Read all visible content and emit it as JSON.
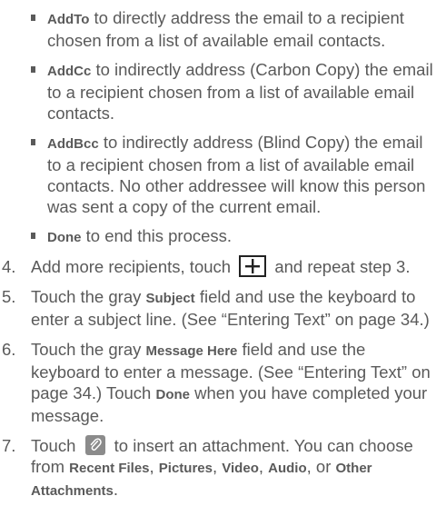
{
  "bullets": [
    {
      "term": "AddTo",
      "text": " to directly address the email to a recipient chosen from a list of available email contacts."
    },
    {
      "term": "AddCc",
      "text": " to indirectly address (Carbon Copy) the email to a recipient chosen from a list of available email contacts."
    },
    {
      "term": "AddBcc",
      "text": " to indirectly address (Blind Copy) the email to a recipient chosen from a list of available email contacts. No other addressee will know this person was sent a copy of the current email."
    },
    {
      "term": "Done",
      "text": " to end this process."
    }
  ],
  "steps": {
    "s4": {
      "num": "4.",
      "before": "Add more recipients, touch",
      "after": "and repeat step 3."
    },
    "s5": {
      "num": "5.",
      "a": "Touch the gray ",
      "term": "Subject",
      "b": " field and use the keyboard to enter a subject line. (See “Entering Text” on page 34.)"
    },
    "s6": {
      "num": "6.",
      "a": "Touch the gray ",
      "term1": "Message Here",
      "b": " field and use the keyboard to enter a message. (See “Entering Text” on page 34.) Touch ",
      "term2": "Done",
      "c": " when you have completed your message."
    },
    "s7": {
      "num": "7.",
      "a": "Touch",
      "b": "to insert an attachment. You can choose from ",
      "t1": "Recent Files",
      "sep1": ", ",
      "t2": "Pictures",
      "sep2": ", ",
      "t3": "Video",
      "sep3": ", ",
      "t4": "Audio",
      "sep4": ", or ",
      "t5": "Other Attachments",
      "end": "."
    }
  },
  "icons": {
    "plus": "plus-icon",
    "attachment": "paperclip-icon"
  }
}
